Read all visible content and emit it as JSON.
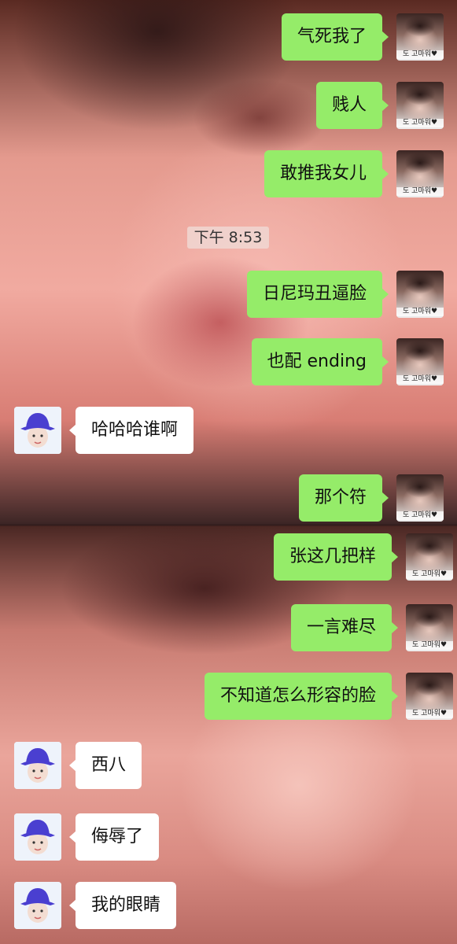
{
  "chat": {
    "timestamp": "下午 8:53",
    "self_avatar_caption": "도 고마워♥",
    "messages": [
      {
        "side": "self",
        "text": "气死我了"
      },
      {
        "side": "self",
        "text": "贱人"
      },
      {
        "side": "self",
        "text": "敢推我女儿"
      },
      {
        "side": "self",
        "text": "日尼玛丑逼脸"
      },
      {
        "side": "self",
        "text": "也配 ending"
      },
      {
        "side": "other",
        "text": "哈哈哈谁啊"
      },
      {
        "side": "self",
        "text": "那个符"
      },
      {
        "side": "self",
        "text": "张这几把样"
      },
      {
        "side": "self",
        "text": "一言难尽"
      },
      {
        "side": "self",
        "text": "不知道怎么形容的脸"
      },
      {
        "side": "other",
        "text": "西八"
      },
      {
        "side": "other",
        "text": "侮辱了"
      },
      {
        "side": "other",
        "text": "我的眼睛"
      }
    ]
  },
  "colors": {
    "self_bubble": "#95ec69",
    "other_bubble": "#ffffff",
    "other_hat": "#4a3fd0"
  },
  "icons": {
    "self_avatar": "dark-hair-portrait-avatar",
    "other_avatar": "blue-bucket-hat-avatar"
  }
}
